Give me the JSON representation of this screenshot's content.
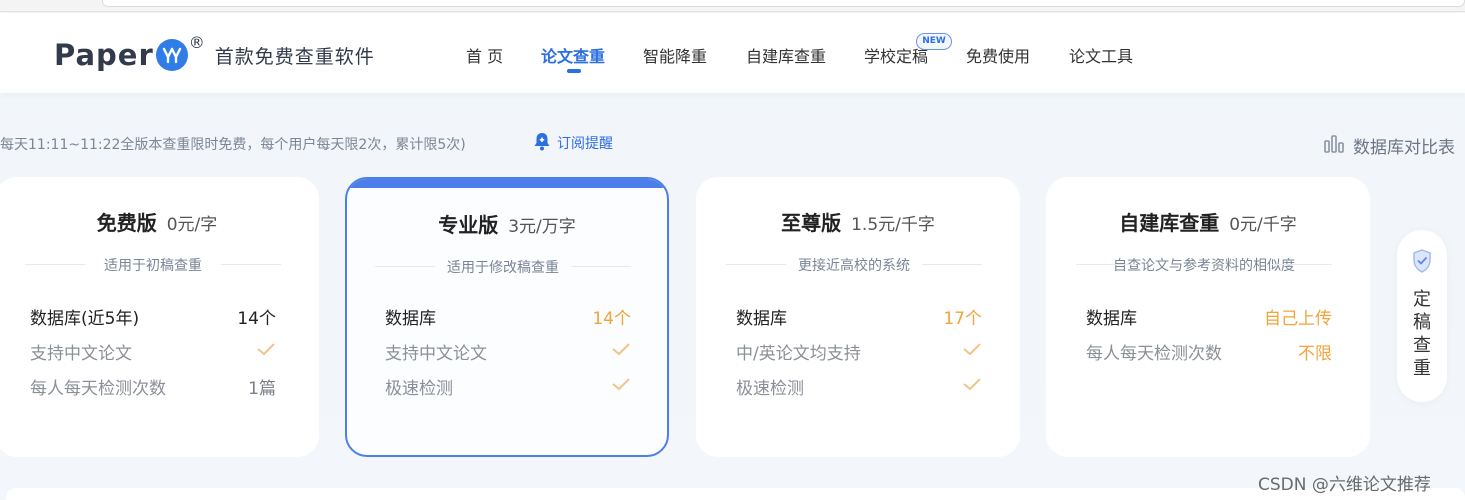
{
  "brand": {
    "word": "Paper",
    "registered": "®",
    "slogan": "首款免费查重软件",
    "brand_color": "#2f7de6"
  },
  "nav": {
    "items": [
      {
        "label": "首 页",
        "active": false
      },
      {
        "label": "论文查重",
        "active": true
      },
      {
        "label": "智能降重",
        "active": false
      },
      {
        "label": "自建库查重",
        "active": false
      },
      {
        "label": "学校定稿",
        "active": false
      },
      {
        "label": "免费使用",
        "active": false
      },
      {
        "label": "论文工具",
        "active": false
      }
    ],
    "new_badge": "NEW",
    "accent_color": "#2c6fe0"
  },
  "notice": {
    "text": "每天11:11~11:22全版本查重限时免费，每个用户每天限2次，累计限5次)",
    "subscribe_label": "订阅提醒",
    "subscribe_icon": "bell-icon",
    "compare_label": "数据库对比表",
    "compare_icon": "bar-chart-icon"
  },
  "plans": [
    {
      "name": "免费版",
      "price": "0元/字",
      "subtitle": "适用于初稿查重",
      "rows": [
        {
          "label": "数据库(近5年)",
          "value": "14个"
        },
        {
          "label": "支持中文论文",
          "value": "✓"
        },
        {
          "label": "每人每天检测次数",
          "value": "1篇"
        }
      ]
    },
    {
      "name": "专业版",
      "price": "3元/万字",
      "subtitle": "适用于修改稿查重",
      "rows": [
        {
          "label": "数据库",
          "value": "14个"
        },
        {
          "label": "支持中文论文",
          "value": "✓"
        },
        {
          "label": "极速检测",
          "value": "✓"
        }
      ]
    },
    {
      "name": "至尊版",
      "price": "1.5元/千字",
      "subtitle": "更接近高校的系统",
      "rows": [
        {
          "label": "数据库",
          "value": "17个"
        },
        {
          "label": "中/英论文均支持",
          "value": "✓"
        },
        {
          "label": "极速检测",
          "value": "✓"
        }
      ]
    },
    {
      "name": "自建库查重",
      "price": "0元/千字",
      "subtitle": "自查论文与参考资料的相似度",
      "rows": [
        {
          "label": "数据库",
          "value": "自己上传"
        },
        {
          "label": "每人每天检测次数",
          "value": "不限"
        }
      ]
    }
  ],
  "side_button": {
    "chars": [
      "定",
      "稿",
      "查",
      "重"
    ],
    "icon": "shield-check-icon"
  },
  "watermark": "CSDN @六维论文推荐",
  "colors": {
    "highlight_orange": "#f0a43a",
    "check_color": "#f0c48a",
    "selected_border": "#4c7fea"
  }
}
